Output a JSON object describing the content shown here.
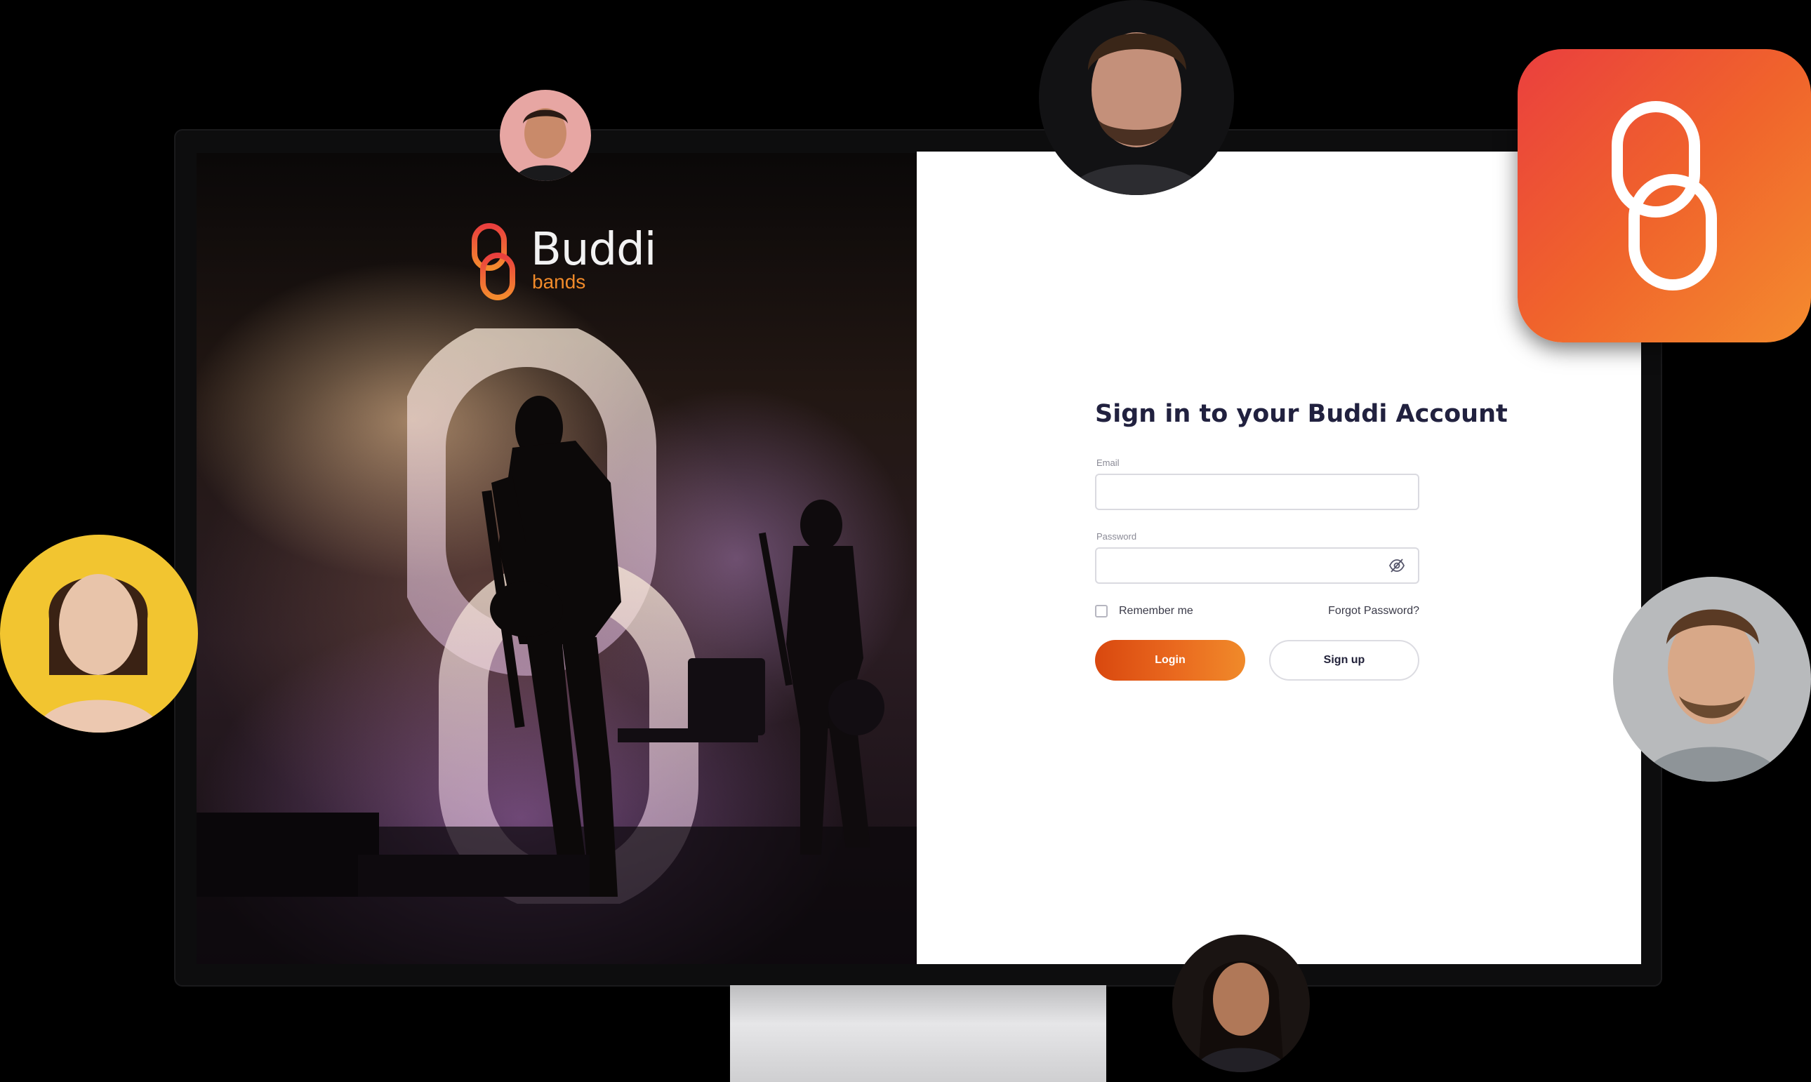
{
  "brand": {
    "name": "Buddi",
    "sub": "bands",
    "accent": "#f08a2a",
    "gradient": [
      "#ea3f3e",
      "#f48b2e"
    ]
  },
  "signin": {
    "title": "Sign in to your Buddi Account",
    "email_label": "Email",
    "email_value": "",
    "password_label": "Password",
    "password_value": "",
    "remember_label": "Remember me",
    "forgot_label": "Forgot Password?",
    "login_label": "Login",
    "signup_label": "Sign up"
  },
  "icons": {
    "password_toggle": "eye-off-icon",
    "app_logo": "chain-link-logo-icon"
  },
  "avatars": [
    {
      "name": "avatar-man-top-left",
      "bg": "#e7a6a3"
    },
    {
      "name": "avatar-man-top-center",
      "bg": "#2a2a2c"
    },
    {
      "name": "avatar-woman-left",
      "bg": "#f2c530"
    },
    {
      "name": "avatar-man-right",
      "bg": "#b8babc"
    },
    {
      "name": "avatar-woman-bottom",
      "bg": "#3a2a22"
    }
  ]
}
